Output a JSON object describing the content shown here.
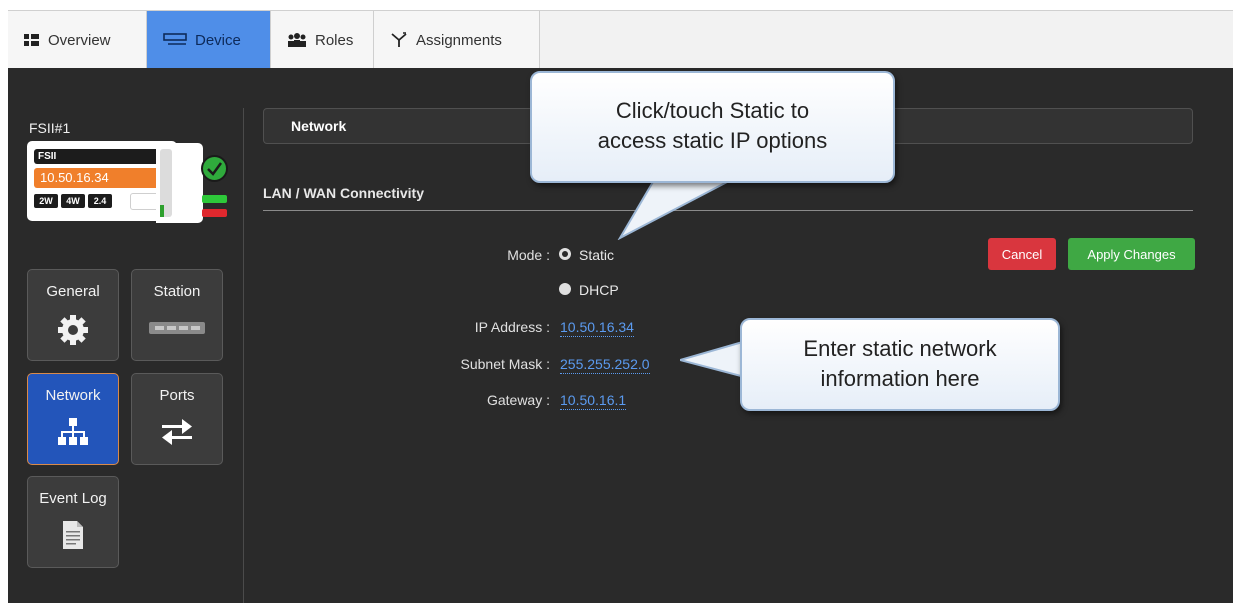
{
  "tabs": [
    {
      "label": "Overview",
      "icon": "grid-icon"
    },
    {
      "label": "Device",
      "icon": "device-icon"
    },
    {
      "label": "Roles",
      "icon": "people-icon"
    },
    {
      "label": "Assignments",
      "icon": "assignment-icon"
    }
  ],
  "device": {
    "name": "FSII#1",
    "card_name": "FSII",
    "ip": "10.50.16.34",
    "pills": [
      "2W",
      "4W",
      "2.4"
    ]
  },
  "tiles": [
    {
      "label": "General",
      "icon": "gear-icon"
    },
    {
      "label": "Station",
      "icon": "station-icon"
    },
    {
      "label": "Network",
      "icon": "network-icon"
    },
    {
      "label": "Ports",
      "icon": "arrows-icon"
    },
    {
      "label": "Event Log",
      "icon": "document-icon"
    }
  ],
  "section": {
    "title": "Network",
    "subtitle": "LAN / WAN Connectivity"
  },
  "form": {
    "mode_label": "Mode :",
    "mode_options": [
      "Static",
      "DHCP"
    ],
    "selected_mode": "Static",
    "ip_label": "IP Address :",
    "ip_value": "10.50.16.34",
    "subnet_label": "Subnet Mask :",
    "subnet_value": "255.255.252.0",
    "gateway_label": "Gateway :",
    "gateway_value": "10.50.16.1"
  },
  "buttons": {
    "cancel": "Cancel",
    "apply": "Apply Changes"
  },
  "callouts": {
    "static_line1": "Click/touch Static to",
    "static_line2": "access static IP options",
    "network_line1": "Enter static network",
    "network_line2": "information here"
  },
  "colors": {
    "accent_tab": "#4f8ee8",
    "device_ip": "#f07f2b",
    "cancel": "#d9363e",
    "apply": "#3fa844",
    "active_tile": "#2355ba"
  }
}
